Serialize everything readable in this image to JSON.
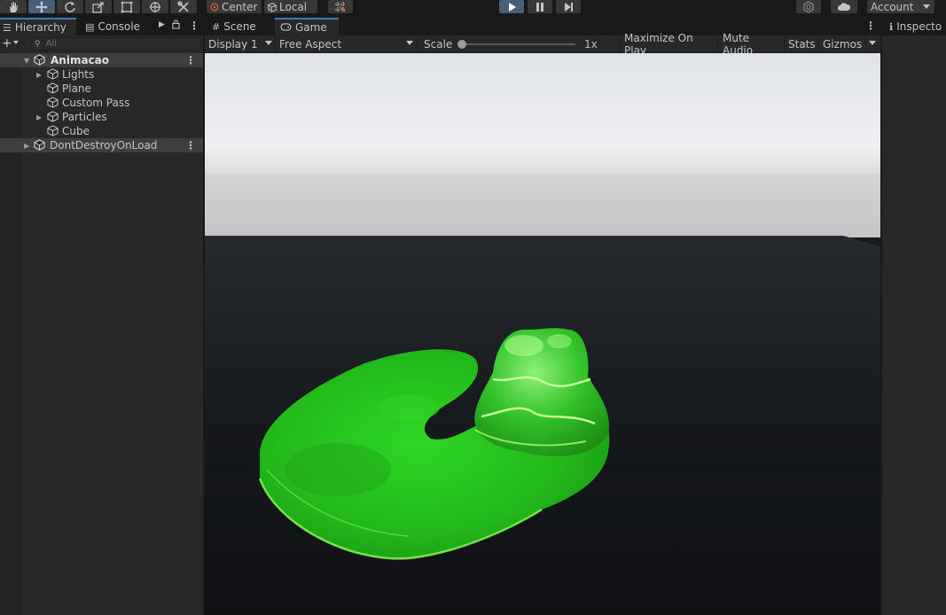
{
  "toolbar": {
    "pivot_label": "Center",
    "space_label": "Local",
    "account_label": "Account"
  },
  "hierarchy": {
    "tab_hierarchy": "Hierarchy",
    "tab_console": "Console",
    "search_placeholder": "All",
    "scene_name": "Animacao",
    "items": [
      {
        "label": "Lights",
        "expandable": true
      },
      {
        "label": "Plane",
        "expandable": false
      },
      {
        "label": "Custom Pass",
        "expandable": false
      },
      {
        "label": "Particles",
        "expandable": true
      },
      {
        "label": "Cube",
        "expandable": false
      }
    ],
    "dont_destroy": "DontDestroyOnLoad"
  },
  "game": {
    "tab_scene": "Scene",
    "tab_game": "Game",
    "display": "Display 1",
    "aspect": "Free Aspect",
    "scale_label": "Scale",
    "scale_value": "1x",
    "maximize": "Maximize On Play",
    "mute": "Mute Audio",
    "stats": "Stats",
    "gizmos": "Gizmos"
  },
  "inspector": {
    "tab": "Inspecto"
  },
  "colors": {
    "accent": "#3a79bb",
    "panel": "#282828",
    "slime": "#22c21a"
  }
}
